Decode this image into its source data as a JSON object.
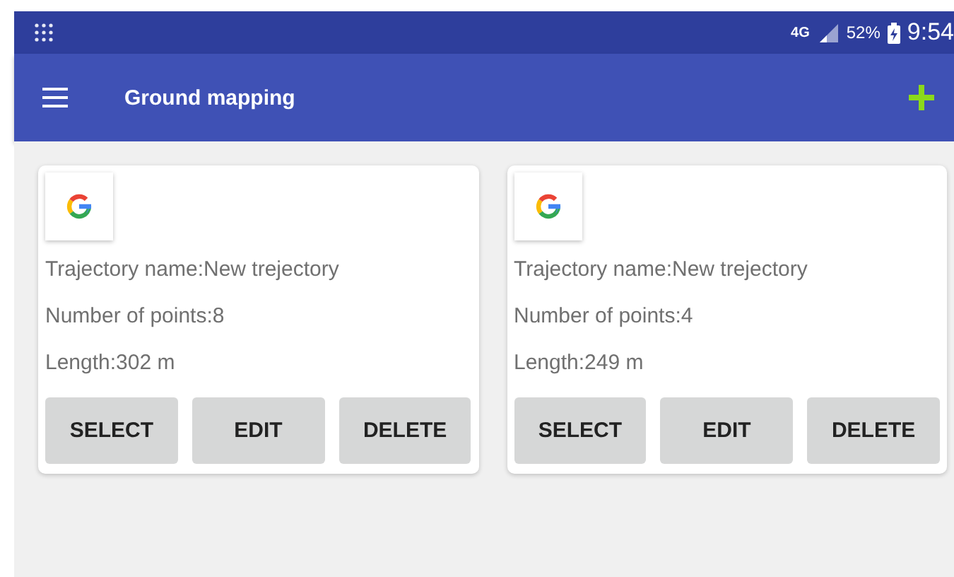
{
  "status_bar": {
    "network": "4G",
    "battery": "52%",
    "time": "9:54"
  },
  "app_bar": {
    "title": "Ground mapping"
  },
  "cards": [
    {
      "name": "Trajectory name:New trejectory",
      "points": "Number of points:8",
      "length": "Length:302 m",
      "buttons": [
        "SELECT",
        "EDIT",
        "DELETE"
      ]
    },
    {
      "name": "Trajectory name:New trejectory",
      "points": "Number of points:4",
      "length": "Length:249 m",
      "buttons": [
        "SELECT",
        "EDIT",
        "DELETE"
      ]
    }
  ]
}
